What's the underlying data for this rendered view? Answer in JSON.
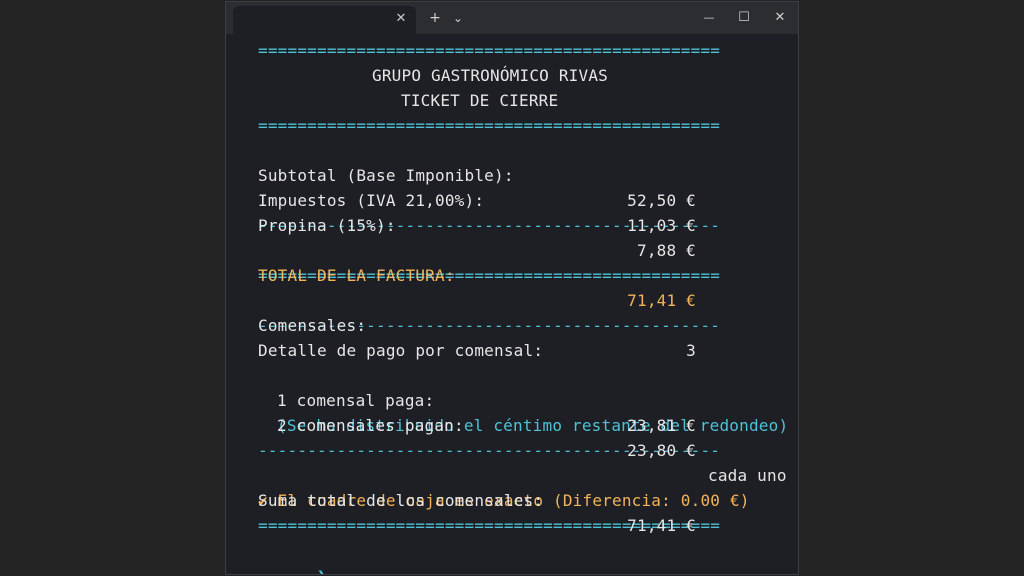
{
  "window": {
    "new_tab_label": "+",
    "dropdown_glyph": "⌄",
    "tab_close_glyph": "✕",
    "minimize_glyph": "—",
    "maximize_glyph": "☐",
    "close_glyph": "✕"
  },
  "terminal": {
    "separator_double": "===============================================",
    "separator_single": "-----------------------------------------------",
    "company": "GRUPO GASTRONÓMICO RIVAS",
    "ticket_title": "TICKET DE CIERRE",
    "subtotal": {
      "label": "Subtotal (Base Imponible):",
      "value": "52,50 €"
    },
    "taxes": {
      "label": "Impuestos (IVA 21,00%):",
      "value": "11,03 €"
    },
    "tip": {
      "label": "Propina (15%):",
      "value": "7,88 €"
    },
    "total": {
      "label": "TOTAL DE LA FACTURA:",
      "value": "71,41 €"
    },
    "diners": {
      "label": "Comensales:",
      "value": "3"
    },
    "payment_header": "Detalle de pago por comensal:",
    "payment_one": {
      "label": "1 comensal paga:",
      "value": "23,81 €"
    },
    "payment_two": {
      "label": "2 comensales pagan:",
      "value": "23,80 €",
      "suffix": "cada uno"
    },
    "rounding_note": "(Se ha distribuido el céntimo restante del redondeo)",
    "sum_diners": {
      "label": "Suma total de los comensales:",
      "value": "71,41 €"
    },
    "check_message": "✔ El cuadre de caja es exacto (Diferencia: 0.00 €)",
    "prompt_glyph": "❯"
  },
  "colors": {
    "separator": "#4fc1d6",
    "highlight": "#f2b35a",
    "text": "#e6e6e6",
    "background": "#1e1f24"
  }
}
